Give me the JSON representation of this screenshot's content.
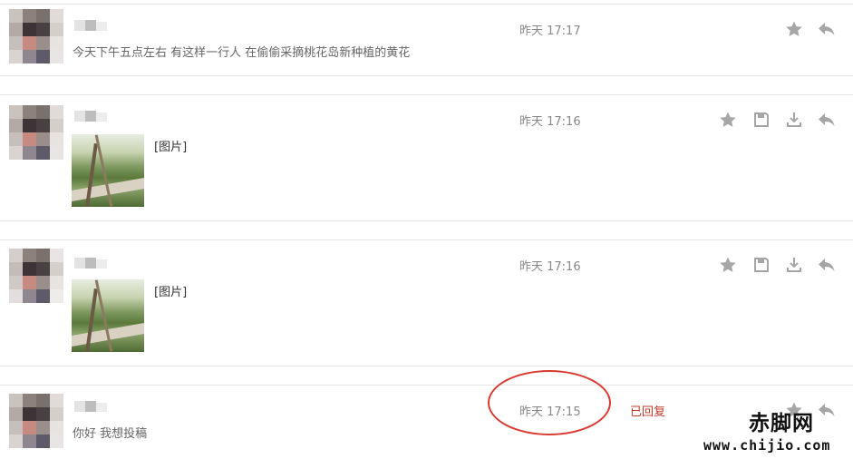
{
  "messages": [
    {
      "time": "昨天 17:17",
      "text": "今天下午五点左右 有这样一行人 在偷偷采摘桃花岛新种植的黄花",
      "tag": "",
      "replied": ""
    },
    {
      "time": "昨天 17:16",
      "text": "",
      "tag": "[图片]",
      "replied": ""
    },
    {
      "time": "昨天 17:16",
      "text": "",
      "tag": "[图片]",
      "replied": ""
    },
    {
      "time": "昨天 17:15",
      "text": "你好 我想投稿",
      "tag": "",
      "replied": "已回复"
    }
  ],
  "icons": {
    "star": "star-icon",
    "save": "save-icon",
    "download": "download-icon",
    "reply": "reply-icon"
  },
  "colors": {
    "replied": "#c0392b",
    "icon": "#a6a6a6",
    "annotation": "#d93a30"
  },
  "watermark": {
    "title": "赤脚网",
    "url": "www.chijio.com"
  }
}
